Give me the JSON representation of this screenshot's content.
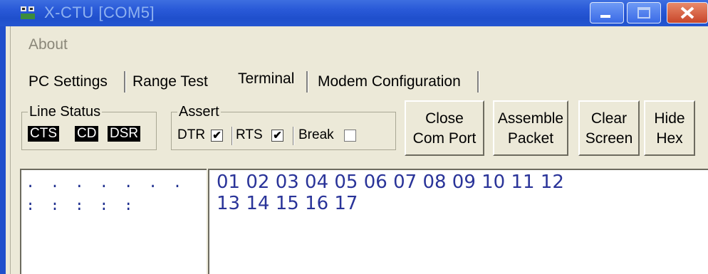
{
  "window": {
    "title": "X-CTU [COM5]"
  },
  "menu": {
    "about": "About"
  },
  "tabs": [
    {
      "label": "PC Settings"
    },
    {
      "label": "Range Test"
    },
    {
      "label": "Terminal",
      "active": true
    },
    {
      "label": "Modem Configuration"
    }
  ],
  "line_status": {
    "title": "Line Status",
    "indicators": [
      "CTS",
      "CD",
      "DSR"
    ]
  },
  "assert": {
    "title": "Assert",
    "items": [
      {
        "label": "DTR",
        "checked": true,
        "mark": "✔"
      },
      {
        "label": "RTS",
        "checked": true,
        "mark": "✔"
      },
      {
        "label": "Break",
        "checked": false,
        "mark": ""
      }
    ]
  },
  "buttons": {
    "close_port": [
      "Close",
      "Com Port"
    ],
    "assemble": [
      "Assemble",
      "Packet"
    ],
    "clear": [
      "Clear",
      "Screen"
    ],
    "hide_hex": [
      "Hide",
      "Hex"
    ]
  },
  "terminal": {
    "ascii_lines": [
      ". . . . . . . . . . . .",
      ". . . . ."
    ],
    "hex_lines": [
      "01 02 03 04 05 06 07 08 09 10 11 12",
      "13 14 15 16 17"
    ]
  },
  "colors": {
    "titlebar": "#2456d0",
    "text_color": "#2a3499",
    "indicator_bg": "#000000"
  }
}
